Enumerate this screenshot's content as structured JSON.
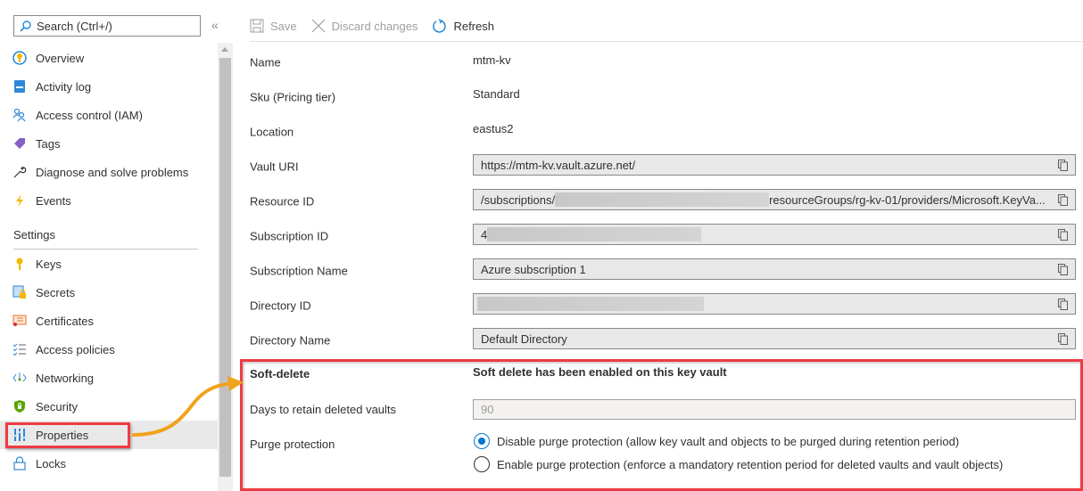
{
  "sidebar": {
    "search_placeholder": "Search (Ctrl+/)",
    "collapse_glyph": "«",
    "items": [
      {
        "label": "Overview",
        "icon": "overview-key-icon"
      },
      {
        "label": "Activity log",
        "icon": "activity-log-icon"
      },
      {
        "label": "Access control (IAM)",
        "icon": "people-icon"
      },
      {
        "label": "Tags",
        "icon": "tag-icon"
      },
      {
        "label": "Diagnose and solve problems",
        "icon": "wrench-icon"
      },
      {
        "label": "Events",
        "icon": "lightning-icon"
      }
    ],
    "settings_header": "Settings",
    "settings_items": [
      {
        "label": "Keys",
        "icon": "key-icon"
      },
      {
        "label": "Secrets",
        "icon": "secret-icon"
      },
      {
        "label": "Certificates",
        "icon": "certificate-icon"
      },
      {
        "label": "Access policies",
        "icon": "checklist-icon"
      },
      {
        "label": "Networking",
        "icon": "networking-icon"
      },
      {
        "label": "Security",
        "icon": "shield-icon"
      },
      {
        "label": "Properties",
        "icon": "properties-icon",
        "selected": true
      },
      {
        "label": "Locks",
        "icon": "lock-icon"
      }
    ]
  },
  "toolbar": {
    "save_label": "Save",
    "discard_label": "Discard changes",
    "refresh_label": "Refresh"
  },
  "properties": {
    "name": {
      "label": "Name",
      "value": "mtm-kv"
    },
    "sku": {
      "label": "Sku (Pricing tier)",
      "value": "Standard"
    },
    "location": {
      "label": "Location",
      "value": "eastus2"
    },
    "vault_uri": {
      "label": "Vault URI",
      "value": "https://mtm-kv.vault.azure.net/"
    },
    "resource_id": {
      "label": "Resource ID",
      "prefix": "/subscriptions/",
      "suffix": "resourceGroups/rg-kv-01/providers/Microsoft.KeyVa..."
    },
    "subscription_id": {
      "label": "Subscription ID",
      "prefix": "4"
    },
    "subscription_name": {
      "label": "Subscription Name",
      "value": "Azure subscription 1"
    },
    "directory_id": {
      "label": "Directory ID"
    },
    "directory_name": {
      "label": "Directory Name",
      "value": "Default Directory"
    }
  },
  "soft_delete": {
    "title": "Soft-delete",
    "message": "Soft delete has been enabled on this key vault",
    "days_label": "Days to retain deleted vaults",
    "days_value": "90",
    "purge_label": "Purge protection",
    "options": [
      {
        "label": "Disable purge protection (allow key vault and objects to be purged during retention period)",
        "checked": true
      },
      {
        "label": "Enable purge protection (enforce a mandatory retention period for deleted vaults and vault objects)",
        "checked": false
      }
    ]
  },
  "colors": {
    "accent": "#0078d4",
    "highlight": "#ee3b43",
    "arrow": "#f0a31c"
  }
}
